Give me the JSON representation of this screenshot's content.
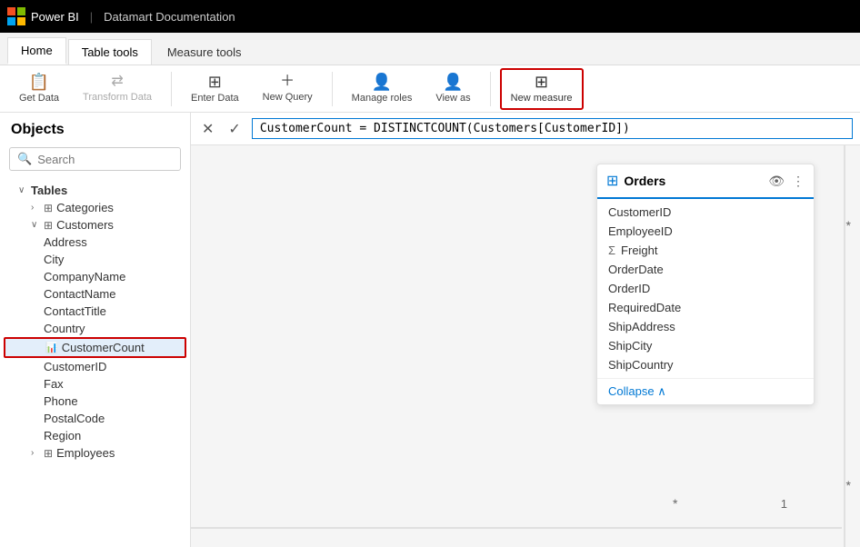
{
  "titleBar": {
    "brand": "Power BI",
    "separator": "|",
    "title": "Datamart Documentation"
  },
  "tabs": [
    {
      "id": "home",
      "label": "Home",
      "active": false
    },
    {
      "id": "table-tools",
      "label": "Table tools",
      "active": true
    },
    {
      "id": "measure-tools",
      "label": "Measure tools",
      "active": false
    }
  ],
  "ribbon": {
    "buttons": [
      {
        "id": "get-data",
        "icon": "📋",
        "label": "Get Data",
        "disabled": false
      },
      {
        "id": "transform-data",
        "icon": "🔄",
        "label": "Transform Data",
        "disabled": true
      },
      {
        "id": "enter-data",
        "icon": "⊞",
        "label": "Enter Data",
        "disabled": false
      },
      {
        "id": "new-query",
        "icon": "+",
        "label": "New Query",
        "disabled": false
      },
      {
        "id": "manage-roles",
        "icon": "👤",
        "label": "Manage roles",
        "disabled": false
      },
      {
        "id": "view-as",
        "icon": "👤",
        "label": "View as",
        "disabled": false
      },
      {
        "id": "new-measure",
        "icon": "⊞",
        "label": "New measure",
        "disabled": false,
        "highlighted": true
      }
    ]
  },
  "leftPanel": {
    "header": "Objects",
    "search": {
      "placeholder": "Search",
      "value": ""
    },
    "tree": {
      "tablesLabel": "Tables",
      "items": [
        {
          "id": "categories",
          "label": "Categories",
          "level": 1,
          "type": "table",
          "expanded": false
        },
        {
          "id": "customers",
          "label": "Customers",
          "level": 1,
          "type": "table",
          "expanded": true
        },
        {
          "id": "address",
          "label": "Address",
          "level": 2,
          "type": "field"
        },
        {
          "id": "city",
          "label": "City",
          "level": 2,
          "type": "field"
        },
        {
          "id": "companyname",
          "label": "CompanyName",
          "level": 2,
          "type": "field"
        },
        {
          "id": "contactname",
          "label": "ContactName",
          "level": 2,
          "type": "field"
        },
        {
          "id": "contacttitle",
          "label": "ContactTitle",
          "level": 2,
          "type": "field"
        },
        {
          "id": "country",
          "label": "Country",
          "level": 2,
          "type": "field"
        },
        {
          "id": "customercount",
          "label": "CustomerCount",
          "level": 2,
          "type": "measure",
          "selected": true
        },
        {
          "id": "customerid",
          "label": "CustomerID",
          "level": 2,
          "type": "field"
        },
        {
          "id": "fax",
          "label": "Fax",
          "level": 2,
          "type": "field"
        },
        {
          "id": "phone",
          "label": "Phone",
          "level": 2,
          "type": "field"
        },
        {
          "id": "postalcode",
          "label": "PostalCode",
          "level": 2,
          "type": "field"
        },
        {
          "id": "region",
          "label": "Region",
          "level": 2,
          "type": "field"
        },
        {
          "id": "employees",
          "label": "Employees",
          "level": 1,
          "type": "table",
          "expanded": false
        }
      ]
    }
  },
  "formulaBar": {
    "cancelBtn": "✕",
    "confirmBtn": "✓",
    "formula": "CustomerCount = DISTINCTCOUNT(Customers[CustomerID])"
  },
  "ordersCard": {
    "title": "Orders",
    "fields": [
      {
        "id": "customerid",
        "label": "CustomerID",
        "hasSigma": false
      },
      {
        "id": "employeeid",
        "label": "EmployeeID",
        "hasSigma": false
      },
      {
        "id": "freight",
        "label": "Freight",
        "hasSigma": true
      },
      {
        "id": "orderdate",
        "label": "OrderDate",
        "hasSigma": false
      },
      {
        "id": "orderid",
        "label": "OrderID",
        "hasSigma": false
      },
      {
        "id": "requireddate",
        "label": "RequiredDate",
        "hasSigma": false
      },
      {
        "id": "shipaddress",
        "label": "ShipAddress",
        "hasSigma": false
      },
      {
        "id": "shipcity",
        "label": "ShipCity",
        "hasSigma": false
      },
      {
        "id": "shipcountry",
        "label": "ShipCountry",
        "hasSigma": false
      }
    ],
    "collapseLabel": "Collapse",
    "asterisks": [
      "*",
      "1"
    ]
  }
}
